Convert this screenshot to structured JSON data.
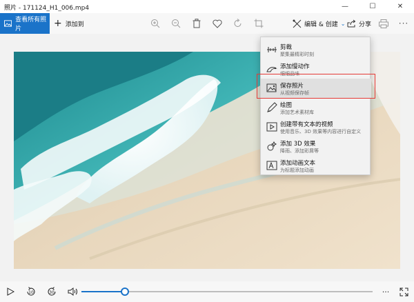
{
  "window": {
    "title": "照片 - 171124_H1_006.mp4"
  },
  "toolbar": {
    "view_all_label": "查看所有照片",
    "add_label": "添加到",
    "edit_create_label": "编辑 & 创建",
    "share_label": "分享"
  },
  "menu": {
    "items": [
      {
        "label": "剪裁",
        "sub": "聚集最精彩时刻",
        "icon": "trim-icon"
      },
      {
        "label": "添加慢动作",
        "sub": "细细品味",
        "icon": "slow-motion-icon"
      },
      {
        "label": "保存照片",
        "sub": "从视频保存帧",
        "icon": "save-photo-icon"
      },
      {
        "label": "绘图",
        "sub": "添加艺术素材库",
        "icon": "draw-icon"
      },
      {
        "label": "创建带有文本的视频",
        "sub": "使用音乐、3D 效果等内容进行自定义",
        "icon": "video-text-icon"
      },
      {
        "label": "添加 3D 效果",
        "sub": "降雨、添加彩屑等",
        "icon": "3d-effect-icon"
      },
      {
        "label": "添加动画文本",
        "sub": "为标题添加动画",
        "icon": "animated-text-icon"
      }
    ]
  },
  "playback": {
    "rewind_label": "10",
    "forward_label": "30",
    "progress": 0.15
  },
  "colors": {
    "accent": "#1a73c9",
    "highlight_box": "#e53935"
  }
}
